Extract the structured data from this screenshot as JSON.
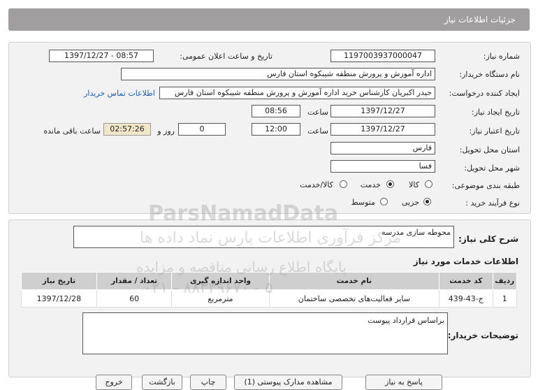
{
  "header": {
    "title": "جزئیات اطلاعات نیاز"
  },
  "form": {
    "need_number_label": "شماره نیاز:",
    "need_number": "1197003937000047",
    "announce_label": "تاریخ و ساعت اعلان عمومی:",
    "announce_value": "1397/12/27 - 08:57",
    "buyer_org_label": "نام دستگاه خریدار:",
    "buyer_org": "اداره آموزش و پرورش منطقه شیبکوه استان فارس",
    "requester_label": "ایجاد کننده درخواست:",
    "requester": "حیدر اکبریان کارشناس خرید اداره آموزش و پرورش منطقه شیبکوه استان فارس",
    "contact_link": "اطلاعات تماس خریدار",
    "created_date_label": "تاریخ ایجاد نیاز:",
    "created_date": "1397/12/27",
    "time_label": "ساعت",
    "created_time": "08:56",
    "validity_label": "تاریخ اعتبار نیاز:",
    "validity_date": "1397/12/27",
    "validity_time": "12:00",
    "days_value": "0",
    "days_label": "روز و",
    "remaining_time": "02:57:26",
    "remaining_label": "ساعت باقی مانده",
    "province_label": "استان محل تحویل:",
    "province": "فارس",
    "city_label": "شهر محل تحویل:",
    "city": "فسا",
    "category_label": "طبقه بندی موضوعی:",
    "category_options": [
      "کالا",
      "خدمت",
      "کالا/خدمت"
    ],
    "category_selected": 1,
    "process_label": "نوع فرآیند خرید :",
    "process_options": [
      "جزیی",
      "متوسط"
    ],
    "process_selected": 0
  },
  "summary": {
    "label": "شرح کلی نیاز:",
    "value": "محوطه سازی مدرسه"
  },
  "services": {
    "title": "اطلاعات خدمات مورد نیاز",
    "columns": [
      "ردیف",
      "کد خدمت",
      "نام خدمت",
      "واحد اندازه گیری",
      "تعداد / مقدار",
      "تاریخ نیاز"
    ],
    "rows": [
      [
        "1",
        "ج-43-439",
        "سایر فعالیت‌های تخصصی ساختمان",
        "مترمربع",
        "60",
        "1397/12/28"
      ]
    ]
  },
  "buyer_notes": {
    "label": "توضیحات خریدار:",
    "value": "براساس قرارداد پیوست"
  },
  "buttons": {
    "reply": "پاسخ به نیاز",
    "docs": "مشاهده مدارک پیوستی (1)",
    "print": "چاپ",
    "back": "بازگشت",
    "exit": "خروج"
  },
  "watermark": {
    "line1": "ParsNamadData",
    "line2": "مرکز فرآوری اطلاعات پارس نماد داده ها",
    "line3": "پایگاه اطلاع رسانی مناقصه و مزایده",
    "line4": "۰۲۱ - ۸۸۳۴۹۶۷۰ - ۵"
  }
}
